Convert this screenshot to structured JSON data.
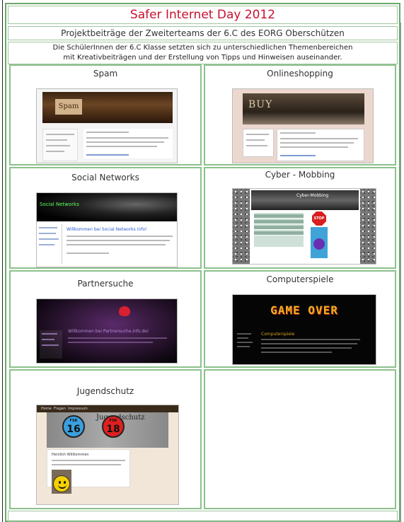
{
  "header": {
    "title": "Safer Internet Day 2012",
    "subtitle": "Projektbeiträge der Zweiterteams der 6.C des EORG Oberschützen",
    "intro_line1": "Die SchülerInnen der 6.C Klasse setzten sich zu unterschiedlichen Themenbereichen",
    "intro_line2": "mit Kreativbeiträgen und der Erstellung von Tipps und Hinweisen auseinander."
  },
  "projects": [
    {
      "title": "Spam",
      "thumb_text": "Spam"
    },
    {
      "title": "Onlineshopping",
      "thumb_text": "BUY"
    },
    {
      "title": "Social Networks",
      "thumb_text": "Social Networks",
      "thumb_heading": "Willkommen bei Social Networks Info!"
    },
    {
      "title": "Cyber - Mobbing",
      "thumb_text": "Cyber-Mobbing",
      "stop_text": "STOP"
    },
    {
      "title": "Partnersuche",
      "thumb_heading": "Willkommen bei Partnersuche.info.de!"
    },
    {
      "title": "Computerspiele",
      "thumb_text": "GAME OVER",
      "thumb_heading": "Computerspiele"
    },
    {
      "title": "Jugendschutz",
      "thumb_text": "Jugendschutz",
      "fsk_label": "FSK",
      "fsk_16": "16",
      "fsk_18": "18",
      "thumb_heading": "Herzlich Willkommen"
    }
  ],
  "jugendschutz_nav": [
    "Home",
    "Fragen",
    "Impressum"
  ]
}
